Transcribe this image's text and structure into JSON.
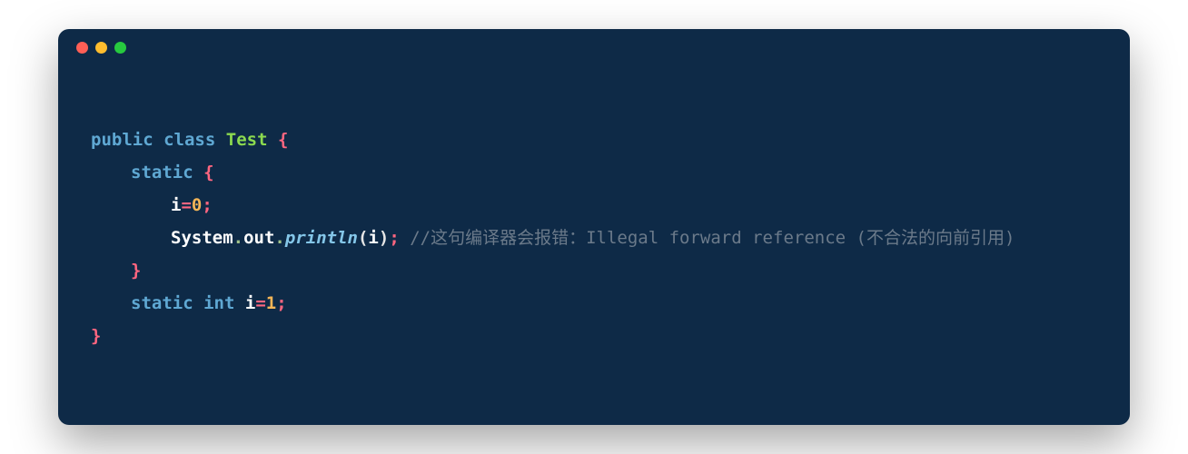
{
  "window": {
    "dots": {
      "red": "#ff5f56",
      "yellow": "#ffbd2e",
      "green": "#27c93f"
    }
  },
  "code": {
    "language": "java",
    "tokens": {
      "l1_public": "public",
      "l1_class": "class",
      "l1_name": "Test",
      "l1_brace": "{",
      "l2_static": "static",
      "l2_brace": "{",
      "l3_var": "i",
      "l3_eq": "=",
      "l3_val": "0",
      "l3_semi": ";",
      "l4_sys": "System",
      "l4_dot1": ".",
      "l4_out": "out",
      "l4_dot2": ".",
      "l4_println": "println",
      "l4_lp": "(",
      "l4_arg": "i",
      "l4_rp": ")",
      "l4_semi": ";",
      "l4_comment": "//这句编译器会报错：Illegal forward reference (不合法的向前引用)",
      "l5_brace": "}",
      "l6_static": "static",
      "l6_int": "int",
      "l6_var": "i",
      "l6_eq": "=",
      "l6_val": "1",
      "l6_semi": ";",
      "l7_brace": "}"
    }
  }
}
